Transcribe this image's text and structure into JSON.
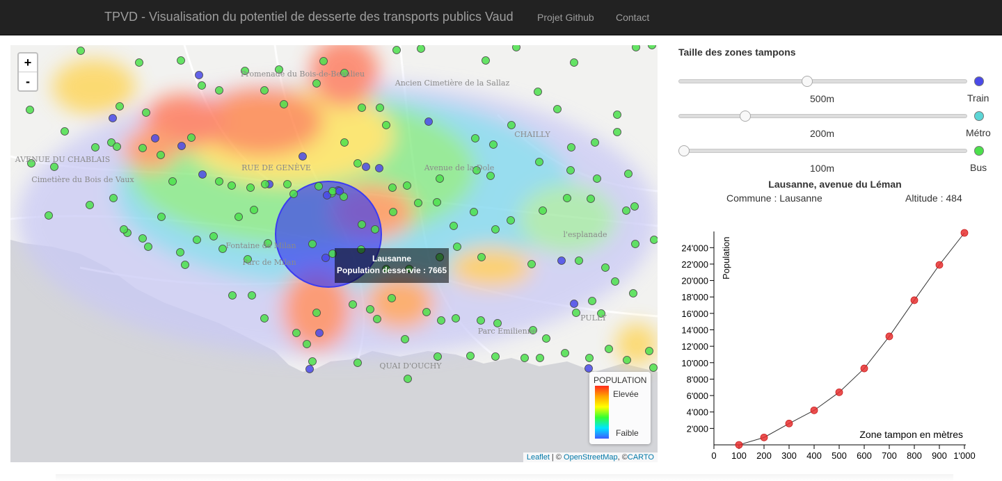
{
  "navbar": {
    "brand": "TPVD - Visualisation du potentiel de desserte des transports publics Vaud",
    "links": [
      "Projet Github",
      "Contact"
    ]
  },
  "map": {
    "zoom_in": "+",
    "zoom_out": "-",
    "labels": [
      "Promenade du Bois-de-Beaulieu",
      "Ancien Cimetière de la Sallaz",
      "CHAILLY",
      "AVENUE DU CHABLAIS",
      "RUE DE GENÈVE",
      "Avenue de la Dole",
      "Cimetière du Bois de Vaux",
      "Fontaine de Milan",
      "Parc de Milan",
      "l'esplanade",
      "PULLY",
      "Parc Emilienne",
      "QUAI D'OUCHY"
    ],
    "tooltip": {
      "title": "Lausanne",
      "text": "Population desservie : 7665"
    },
    "legend": {
      "title": "POPULATION",
      "high": "Elevée",
      "low": "Faible",
      "colors": [
        "#ff2b1c",
        "#ffa500",
        "#ffff00",
        "#33ff33",
        "#00e5ff",
        "#3b5bff"
      ]
    },
    "attribution": {
      "leaflet": "Leaflet",
      "sep1": " | © ",
      "osm": "OpenStreetMap",
      "sep2": ", ©",
      "carto": "CARTO"
    },
    "stop_colors": {
      "train": "#4a4ae8",
      "metro": "#5cd6d6",
      "bus": "#4ce04c"
    }
  },
  "panel": {
    "title": "Taille des zones tampons",
    "sliders": [
      {
        "type": "Train",
        "value_label": "500m",
        "value": 500,
        "color": "#4a4ae8"
      },
      {
        "type": "Métro",
        "value_label": "200m",
        "value": 200,
        "color": "#5cd6d6"
      },
      {
        "type": "Bus",
        "value_label": "100m",
        "value": 100,
        "color": "#4ce04c"
      }
    ],
    "station": {
      "name": "Lausanne, avenue du Léman",
      "commune": "Commune : Lausanne",
      "altitude": "Altitude : 484"
    }
  },
  "chart_data": {
    "type": "line",
    "ylabel": "Population",
    "xlabel": "Zone tampon en mètres",
    "x": [
      100,
      200,
      300,
      400,
      500,
      600,
      700,
      800,
      900,
      1000
    ],
    "series": [
      {
        "values": [
          0,
          900,
          2600,
          4200,
          6400,
          9300,
          13200,
          17600,
          21900,
          25800
        ]
      }
    ],
    "xlim": [
      0,
      1000
    ],
    "ylim": [
      0,
      25800
    ],
    "xticks": [
      "0",
      "100",
      "200",
      "300",
      "400",
      "500",
      "600",
      "700",
      "800",
      "900",
      "1'000"
    ],
    "yticks": [
      "2'000",
      "4'000",
      "6'000",
      "8'000",
      "10'000",
      "12'000",
      "14'000",
      "16'000",
      "18'000",
      "20'000",
      "22'000",
      "24'000"
    ],
    "point_color": "#e83030"
  }
}
